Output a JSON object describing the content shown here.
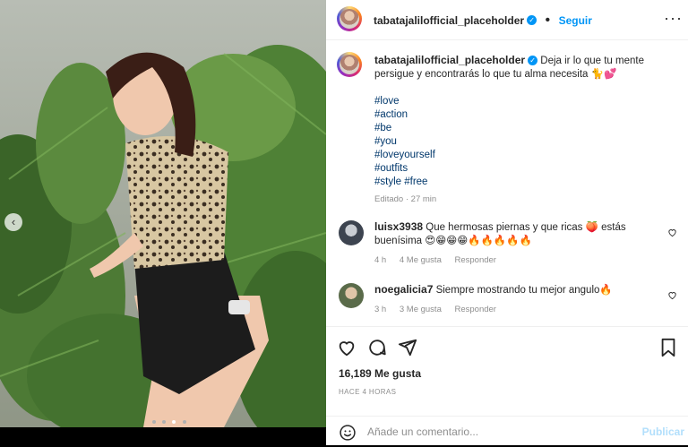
{
  "post": {
    "username": "tabatajalilofficial_placeholder",
    "follow_label": "Seguir",
    "caption_user": "tabatajalilofficial_placeholder",
    "caption_text": "Deja ir lo que tu mente persigue y encontrarás lo que tu alma necesita 🐈💕",
    "hashtags": [
      "#love",
      "#action",
      "#be",
      "#you",
      "#loveyourself",
      "#outfits",
      "#style #free"
    ],
    "edited_meta": "Editado · 27 min",
    "likes": "16,189 Me gusta",
    "time_ago": "HACE 4 HORAS",
    "carousel_count": 4,
    "carousel_active": 3
  },
  "comments": [
    {
      "user": "luisx3938",
      "text": "Que hermosas piernas y que ricas 🍑 estás buenísima 😍😁😁😁🔥🔥🔥🔥🔥",
      "time": "4 h",
      "likes": "4 Me gusta",
      "reply": "Responder"
    },
    {
      "user": "noegalicia7",
      "text": "Siempre mostrando tu mejor angulo🔥",
      "time": "3 h",
      "likes": "3 Me gusta",
      "reply": "Responder"
    }
  ],
  "composer": {
    "placeholder": "Añade un comentario...",
    "publish_label": "Publicar"
  },
  "colors": {
    "accent": "#0095f6",
    "hashtag": "#00376b",
    "muted": "#8e8e8e"
  }
}
